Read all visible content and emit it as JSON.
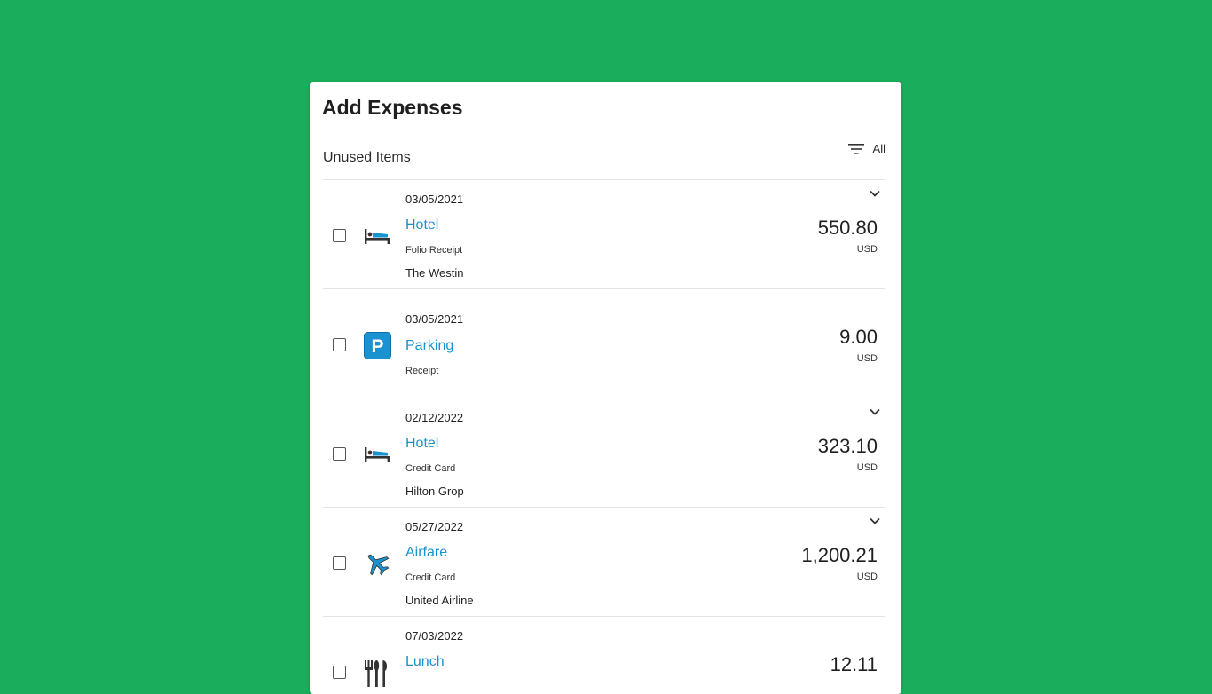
{
  "header": {
    "title": "Add Expenses"
  },
  "section": {
    "label": "Unused Items",
    "filter_label": "All"
  },
  "colors": {
    "background": "#19ad5c",
    "accent": "#1a92cf"
  },
  "items": [
    {
      "date": "03/05/2021",
      "category": "Hotel",
      "icon": "bed-icon",
      "source": "Folio Receipt",
      "vendor": "The Westin",
      "amount": "550.80",
      "currency": "USD",
      "expandable": true
    },
    {
      "date": "03/05/2021",
      "category": "Parking",
      "icon": "parking-icon",
      "source": "Receipt",
      "vendor": "",
      "amount": "9.00",
      "currency": "USD",
      "expandable": false
    },
    {
      "date": "02/12/2022",
      "category": "Hotel",
      "icon": "bed-icon",
      "source": "Credit Card",
      "vendor": "Hilton Grop",
      "amount": "323.10",
      "currency": "USD",
      "expandable": true
    },
    {
      "date": "05/27/2022",
      "category": "Airfare",
      "icon": "airplane-icon",
      "source": "Credit Card",
      "vendor": "United Airline",
      "amount": "1,200.21",
      "currency": "USD",
      "expandable": true
    },
    {
      "date": "07/03/2022",
      "category": "Lunch",
      "icon": "fork-knife-icon",
      "source": "",
      "vendor": "",
      "amount": "12.11",
      "currency": "",
      "expandable": false
    }
  ]
}
